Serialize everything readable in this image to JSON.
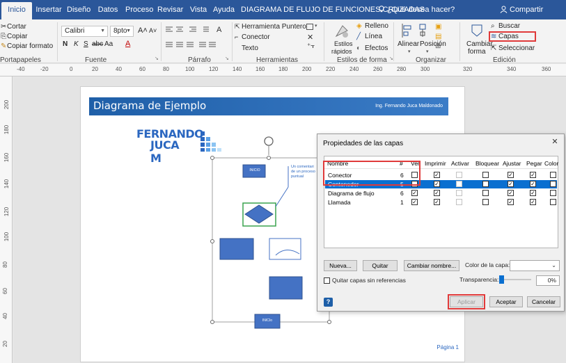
{
  "ribbon_tabs": [
    "Inicio",
    "Insertar",
    "Diseño",
    "Datos",
    "Proceso",
    "Revisar",
    "Vista",
    "Ayuda"
  ],
  "document_title": "DIAGRAMA DE FLUJO DE FUNCIONES CRUZADAS",
  "tell_me": "¿Qué desea hacer?",
  "share": "Compartir",
  "clipboard": {
    "cut": "Cortar",
    "copy": "Copiar",
    "format_painter": "Copiar formato",
    "group_label": "Portapapeles"
  },
  "font": {
    "name": "Calibri",
    "size": "8pto",
    "group_label": "Fuente",
    "bold": "N",
    "italic": "K",
    "underline": "S",
    "strikethrough": "abc",
    "case": "Aa"
  },
  "paragraph": {
    "group_label": "Párrafo"
  },
  "tools": {
    "pointer": "Herramienta Puntero",
    "connector": "Conector",
    "text": "Texto",
    "group_label": "Herramientas"
  },
  "shape_styles": {
    "quick_styles_1": "Estilos",
    "quick_styles_2": "rápidos",
    "fill": "Relleno",
    "line": "Línea",
    "effects": "Efectos",
    "group_label": "Estilos de forma"
  },
  "arrange": {
    "align": "Alinear",
    "position": "Posición",
    "group_label": "Organizar"
  },
  "editing": {
    "change_shape_1": "Cambiar",
    "change_shape_2": "forma",
    "find": "Buscar",
    "layers": "Capas",
    "select": "Seleccionar",
    "group_label": "Edición"
  },
  "ruler_labels": [
    "-40",
    "-20",
    "0",
    "20",
    "40",
    "60",
    "80",
    "100",
    "120",
    "140",
    "160",
    "180",
    "200",
    "220",
    "240",
    "260",
    "280",
    "300",
    "320",
    "340",
    "360"
  ],
  "vruler_labels": [
    "200",
    "180",
    "160",
    "140",
    "120",
    "100",
    "80",
    "60",
    "40",
    "20"
  ],
  "page": {
    "header_title": "Diagrama de Ejemplo",
    "header_author": "Ing. Fernando Juca Maldonado",
    "logo_line1": "FERNANDO",
    "logo_line2": "JUCA M",
    "start_label": "INICIO",
    "end_label": "INICIo",
    "comment_line1": "Un comentari",
    "comment_line2": "de un proceso",
    "comment_line3": "puntual",
    "page_number": "Página 1"
  },
  "dialog": {
    "title": "Propiedades de las capas",
    "close": "✕",
    "columns": [
      "Nombre",
      "#",
      "Ver",
      "Imprimir",
      "Activar",
      "Bloquear",
      "Ajustar",
      "Pegar",
      "Color"
    ],
    "layers": [
      {
        "name": "Conector",
        "count": "6",
        "ver": false,
        "imprimir": true,
        "activar": false,
        "bloquear": false,
        "ajustar": true,
        "pegar": true,
        "color": false,
        "selected": false
      },
      {
        "name": "Contenedor",
        "count": "5",
        "ver": false,
        "imprimir": true,
        "activar": false,
        "bloquear": false,
        "ajustar": true,
        "pegar": true,
        "color": false,
        "selected": true
      },
      {
        "name": "Diagrama de flujo",
        "count": "6",
        "ver": true,
        "imprimir": true,
        "activar": false,
        "bloquear": false,
        "ajustar": true,
        "pegar": true,
        "color": false,
        "selected": false
      },
      {
        "name": "Llamada",
        "count": "1",
        "ver": true,
        "imprimir": true,
        "activar": false,
        "bloquear": false,
        "ajustar": true,
        "pegar": true,
        "color": false,
        "selected": false
      }
    ],
    "new_button": "Nueva...",
    "remove_button": "Quitar",
    "rename_button": "Cambiar nombre...",
    "layer_color_label": "Color de la capa:",
    "remove_unreferenced": "Quitar capas sin referencias",
    "transparency_label": "Transparencia:",
    "transparency_value": "0%",
    "apply_button": "Aplicar",
    "accept_button": "Aceptar",
    "cancel_button": "Cancelar"
  },
  "colors": {
    "ribbon_blue": "#2b579a",
    "shape_blue": "#4472c4",
    "highlight_red": "#e03a3a",
    "selection_blue": "#0a6fd0"
  }
}
